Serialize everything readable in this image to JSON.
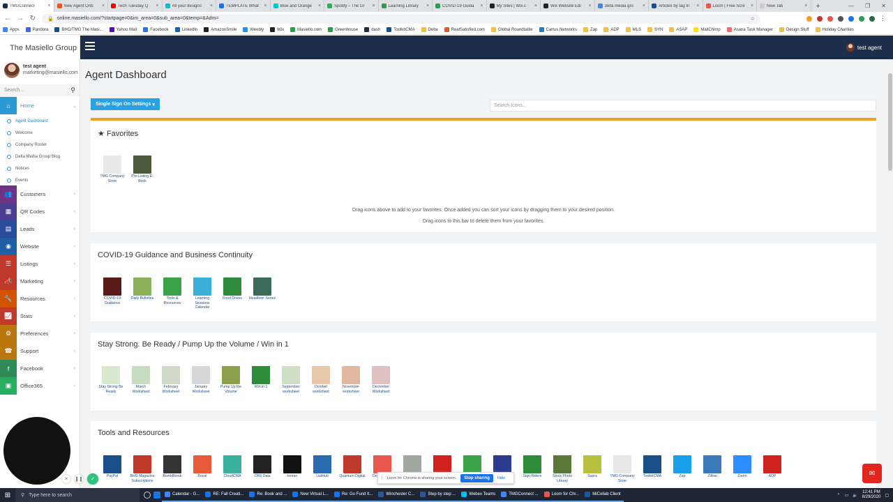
{
  "browser": {
    "tabs": [
      {
        "title": "TMGConnect",
        "color": "#1c2e4a",
        "active": true
      },
      {
        "title": "New Agent Onb",
        "color": "#e85a1c"
      },
      {
        "title": "Tech Tuesday Q",
        "color": "#ff0000"
      },
      {
        "title": "All your designs",
        "color": "#00c4cc"
      },
      {
        "title": "TEMPLATE What",
        "color": "#1a73e8"
      },
      {
        "title": "Blue and Orange",
        "color": "#00c4cc"
      },
      {
        "title": "Spotify – The Gr",
        "color": "#1db954"
      },
      {
        "title": "Learning Library",
        "color": "#2e9c4f"
      },
      {
        "title": "COVID-19 Guida",
        "color": "#2e9c4f"
      },
      {
        "title": "My Sites | Wix.c",
        "color": "#222222"
      },
      {
        "title": "Wix Website Edi",
        "color": "#222222"
      },
      {
        "title": "delta media gro",
        "color": "#4285f4"
      },
      {
        "title": "Articles by tag In",
        "color": "#1b4f8a"
      },
      {
        "title": "Loom | Free Scre",
        "color": "#e8564c"
      },
      {
        "title": "New Tab",
        "color": "#cccccc"
      }
    ],
    "new_tab": "+",
    "url": "online.masiello.com/?startpage=0&im_area=0&sub_area=0&temp=&Adm=",
    "bookmarks": [
      {
        "label": "Apps",
        "color": "#4285f4"
      },
      {
        "label": "Pandora",
        "color": "#3668ff"
      },
      {
        "label": "BHG/TMG The Masi...",
        "color": "#1b4f8a"
      },
      {
        "label": "Yahoo Mail",
        "color": "#6001d2"
      },
      {
        "label": "Facebook",
        "color": "#1877f2"
      },
      {
        "label": "LinkedIn",
        "color": "#0a66c2"
      },
      {
        "label": "AmazonSmile",
        "color": "#222222"
      },
      {
        "label": "Weebly",
        "color": "#2990ea"
      },
      {
        "label": "Wix",
        "color": "#222222"
      },
      {
        "label": "Masiello.com",
        "color": "#2e9c4f"
      },
      {
        "label": "Greenhouse",
        "color": "#2e9c4f"
      },
      {
        "label": "dash",
        "color": "#1c2e4a"
      },
      {
        "label": "ToolkitCMA",
        "color": "#1b4f8a"
      },
      {
        "label": "Delta",
        "color": "#f0c040"
      },
      {
        "label": "RealSatisfied.com",
        "color": "#e85a1c"
      },
      {
        "label": "Global Roundtable",
        "color": "#f0c040"
      },
      {
        "label": "Cartus Networks",
        "color": "#2a7dc4"
      },
      {
        "label": "Zap",
        "color": "#f0c040"
      },
      {
        "label": "ADP",
        "color": "#f0c040"
      },
      {
        "label": "MLS",
        "color": "#f0c040"
      },
      {
        "label": "SYN",
        "color": "#f0c040"
      },
      {
        "label": "ASAP",
        "color": "#f0c040"
      },
      {
        "label": "MailChimp",
        "color": "#ffe01b"
      },
      {
        "label": "Asana Task Manager",
        "color": "#f06a6a"
      },
      {
        "label": "Design Stuff",
        "color": "#f0c040"
      },
      {
        "label": "Holiday Charities",
        "color": "#f0c040"
      }
    ]
  },
  "sidebar": {
    "brand": "The Masiello Group",
    "user_name": "test agent",
    "user_email": "marketing@masiello.com",
    "search_placeholder": "Search...",
    "home": {
      "label": "Home",
      "color": "#2a9ad4"
    },
    "home_subitems": [
      "Agent Dashboard",
      "Welcome",
      "Company Roster",
      "Delta Media Group Blog",
      "Notices",
      "Events"
    ],
    "items": [
      {
        "label": "Customers",
        "color": "#6c3483"
      },
      {
        "label": "QR Codes",
        "color": "#4b3d8f"
      },
      {
        "label": "Leads",
        "color": "#2b4c9b"
      },
      {
        "label": "Website",
        "color": "#1f5fa8"
      },
      {
        "label": "Listings",
        "color": "#c0392b"
      },
      {
        "label": "Marketing",
        "color": "#c0392b"
      },
      {
        "label": "Resources",
        "color": "#d35400"
      },
      {
        "label": "Stats",
        "color": "#c0392b"
      },
      {
        "label": "Preferences",
        "color": "#b9770e"
      },
      {
        "label": "Support",
        "color": "#b9770e"
      },
      {
        "label": "Facebook",
        "color": "#2e8b57"
      },
      {
        "label": "Office365",
        "color": "#27ae60"
      }
    ]
  },
  "topnav": {
    "agent": "test agent"
  },
  "main": {
    "title": "Agent Dashboard",
    "sso_button": "Single Sign On Settings",
    "icon_search_placeholder": "Search Icons...",
    "favorites": {
      "title": "Favorites",
      "tiles": [
        {
          "label": "TMG Company Store",
          "color": "#e8e8e8"
        },
        {
          "label": "Pre-Listing E-Book",
          "color": "#4a5a3a"
        }
      ],
      "drag_text_1": "Drag icons above to add to your favorites. Once added you can sort your icons by dragging them to your desired position.",
      "drag_text_2": "Drag icons to this bar to delete them from your favorites."
    },
    "covid": {
      "title": "COVID-19 Guidance and Business Continuity",
      "tiles": [
        {
          "label": "COVID-19 Guidance",
          "color": "#5a1a1a"
        },
        {
          "label": "Daily Bulletins",
          "color": "#8ab05a"
        },
        {
          "label": "Tools & Resources",
          "color": "#3aa34a"
        },
        {
          "label": "Learning Sessions Calendar",
          "color": "#3ab0d8"
        },
        {
          "label": "Food Drives",
          "color": "#2e8b3a"
        },
        {
          "label": "Headliner Series",
          "color": "#3a6a5a"
        }
      ]
    },
    "stay_strong": {
      "title": "Stay Strong. Be Ready / Pump Up the Volume / Win in 1",
      "tiles": [
        {
          "label": "Stay Strong Be Ready",
          "color": "#d8e8d0"
        },
        {
          "label": "March Worksheet",
          "color": "#c8dcc0"
        },
        {
          "label": "February Worksheet",
          "color": "#d0d8c8"
        },
        {
          "label": "January Worksheet",
          "color": "#d8d8d8"
        },
        {
          "label": "Pump Up the Volume",
          "color": "#8aa04a"
        },
        {
          "label": "Win in 1",
          "color": "#2e8b3a"
        },
        {
          "label": "September worksheet",
          "color": "#d0e0c8"
        },
        {
          "label": "October worksheet",
          "color": "#e8c8a8"
        },
        {
          "label": "November worksheet",
          "color": "#e0b8a0"
        },
        {
          "label": "December Worksheet",
          "color": "#e0c0c0"
        }
      ]
    },
    "tools": {
      "title": "Tools and Resources",
      "tiles": [
        {
          "label": "PayPal",
          "color": "#1b4f8a"
        },
        {
          "label": "BHG Magazine Subscriptions",
          "color": "#c0392b"
        },
        {
          "label": "BombBomb",
          "color": "#333333"
        },
        {
          "label": "Boost",
          "color": "#e85a3a"
        },
        {
          "label": "CloudCMA",
          "color": "#3ab0a0"
        },
        {
          "label": "CRS Data",
          "color": "#222222"
        },
        {
          "label": "Inman",
          "color": "#111111"
        },
        {
          "label": "ListHub",
          "color": "#2a6ab0"
        },
        {
          "label": "Quantum Digital",
          "color": "#c0392b"
        },
        {
          "label": "Delta Media",
          "color": "#e8564c"
        },
        {
          "label": "Masiello",
          "color": "#a0a8a0"
        },
        {
          "label": "Realtor.com",
          "color": "#d0221c"
        },
        {
          "label": "RealSatisfied",
          "color": "#3aa34a"
        },
        {
          "label": "SkySlope",
          "color": "#2b3c8f"
        },
        {
          "label": "Sign Riders",
          "color": "#2e8b3a"
        },
        {
          "label": "Stock Photo Library",
          "color": "#5a7a3a"
        },
        {
          "label": "Supra",
          "color": "#b8c040"
        },
        {
          "label": "TMG Company Store",
          "color": "#e8e8e8"
        },
        {
          "label": "ToolkitCMA",
          "color": "#1b4f8a"
        },
        {
          "label": "Zap",
          "color": "#1aa0e8"
        },
        {
          "label": "Zillow",
          "color": "#3a7ab8"
        },
        {
          "label": "Zoom",
          "color": "#2d8cff"
        },
        {
          "label": "ADP",
          "color": "#d0221c"
        }
      ]
    }
  },
  "overlays": {
    "share_text": "Loom for Chrome is sharing your screen.",
    "stop_sharing": "Stop sharing",
    "hide": "Hide"
  },
  "taskbar": {
    "search_placeholder": "Type here to search",
    "apps": [
      {
        "label": "Calendar - G...",
        "color": "#4285f4"
      },
      {
        "label": "RE: Fall Creati...",
        "color": "#1a73e8"
      },
      {
        "label": "Re: Book and ...",
        "color": "#1a73e8"
      },
      {
        "label": "New Virtual L...",
        "color": "#1a73e8"
      },
      {
        "label": "Re: Go Fund It...",
        "color": "#1a73e8"
      },
      {
        "label": "Winchester C...",
        "color": "#2b579a"
      },
      {
        "label": "Step by step ...",
        "color": "#2b579a"
      },
      {
        "label": "Webex Teams",
        "color": "#00bceb"
      },
      {
        "label": "TMGConnect ...",
        "color": "#4285f4"
      },
      {
        "label": "Loom for Chr...",
        "color": "#e8564c"
      },
      {
        "label": "MiCollab Client",
        "color": "#1a5a9a"
      }
    ],
    "time": "12:41 PM",
    "date": "8/29/2020"
  }
}
